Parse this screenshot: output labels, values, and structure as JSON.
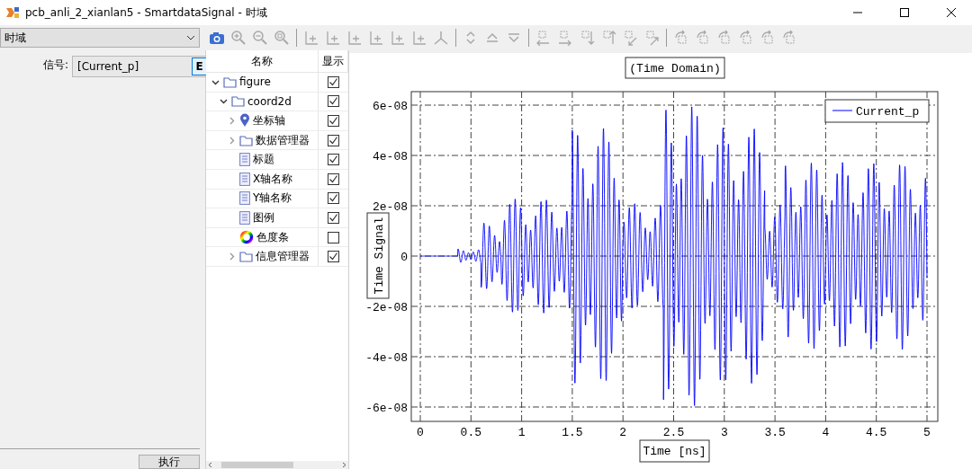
{
  "window": {
    "title": "pcb_anli_2_xianlan5 - SmartdataSignal - 时域"
  },
  "toolbar": {
    "view_select": "时域"
  },
  "signal_panel": {
    "label": "信号:",
    "value": "[Current_p]",
    "edit_button": "E",
    "run_button": "执行"
  },
  "tree": {
    "columns": [
      "名称",
      "显示"
    ],
    "items": [
      {
        "label": "figure",
        "kind": "folder",
        "expanded": true,
        "checked": true,
        "children": [
          {
            "label": "coord2d",
            "kind": "folder",
            "expanded": true,
            "checked": true,
            "children": [
              {
                "label": "坐标轴",
                "kind": "pin",
                "expanded": false,
                "checked": true
              },
              {
                "label": "数据管理器",
                "kind": "folder",
                "expanded": false,
                "checked": true
              },
              {
                "label": "标题",
                "kind": "doc",
                "checked": true
              },
              {
                "label": "X轴名称",
                "kind": "doc",
                "checked": true
              },
              {
                "label": "Y轴名称",
                "kind": "doc",
                "checked": true
              },
              {
                "label": "图例",
                "kind": "doc",
                "checked": true
              },
              {
                "label": "色度条",
                "kind": "colorwheel",
                "checked": false
              },
              {
                "label": "信息管理器",
                "kind": "folder",
                "expanded": false,
                "checked": true
              }
            ]
          }
        ]
      }
    ]
  },
  "plot": {
    "title": "(Time Domain)",
    "xlabel": "Time [ns]",
    "ylabel": "Time Signal",
    "xticks": [
      "0",
      "0.5",
      "1",
      "1.5",
      "2",
      "2.5",
      "3",
      "3.5",
      "4",
      "4.5",
      "5"
    ],
    "yticks": [
      "6e-08",
      "4e-08",
      "2e-08",
      "0",
      "-2e-08",
      "-4e-08",
      "-6e-08"
    ],
    "legend": {
      "name": "Current_p",
      "color": "#0000ff"
    }
  }
}
